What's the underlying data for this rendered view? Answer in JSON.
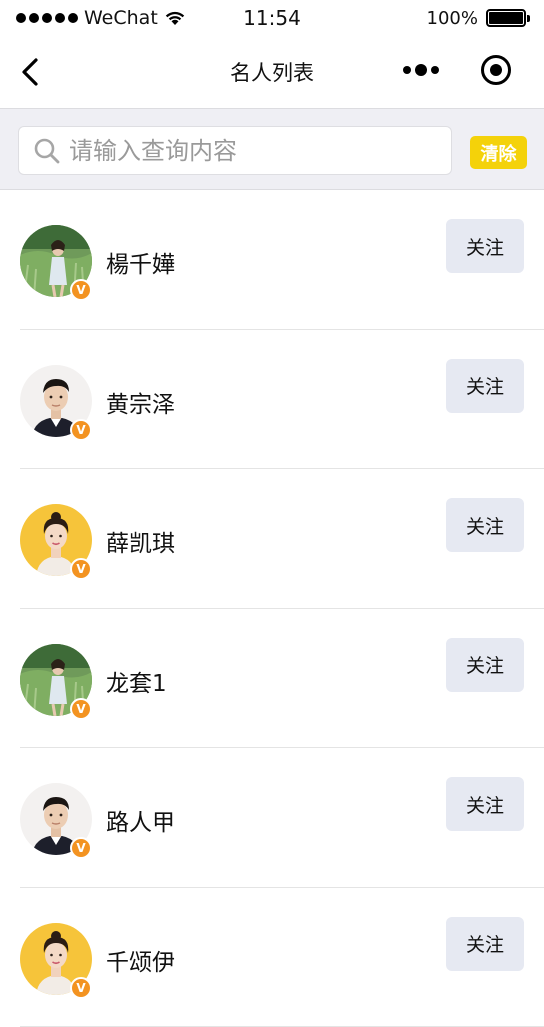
{
  "status_bar": {
    "carrier": "WeChat",
    "time": "11:54",
    "battery": "100%",
    "icons": [
      "signal-dots-icon",
      "wifi-icon",
      "battery-icon"
    ]
  },
  "nav": {
    "title": "名人列表",
    "icons": [
      "back-arrow-icon",
      "more-dots-icon",
      "close-target-icon"
    ]
  },
  "search": {
    "placeholder": "请输入查询内容",
    "value": "",
    "clear_label": "清除",
    "icon": "search-icon"
  },
  "colors": {
    "accent_yellow": "#f4d20a",
    "badge_orange": "#f39321",
    "follow_button_bg": "#e6e9f2",
    "search_area_bg": "#efeff4"
  },
  "celebrities": [
    {
      "name": "楊千嬅",
      "follow_label": "关注",
      "avatar": "avatar-grass-field",
      "verified": true
    },
    {
      "name": "黄宗泽",
      "follow_label": "关注",
      "avatar": "avatar-man-portrait",
      "verified": true
    },
    {
      "name": "薛凯琪",
      "follow_label": "关注",
      "avatar": "avatar-yellow-bg",
      "verified": true
    },
    {
      "name": "龙套1",
      "follow_label": "关注",
      "avatar": "avatar-grass-field",
      "verified": true
    },
    {
      "name": "路人甲",
      "follow_label": "关注",
      "avatar": "avatar-man-portrait",
      "verified": true
    },
    {
      "name": "千颂伊",
      "follow_label": "关注",
      "avatar": "avatar-yellow-bg",
      "verified": true
    }
  ],
  "badge_label": "V"
}
